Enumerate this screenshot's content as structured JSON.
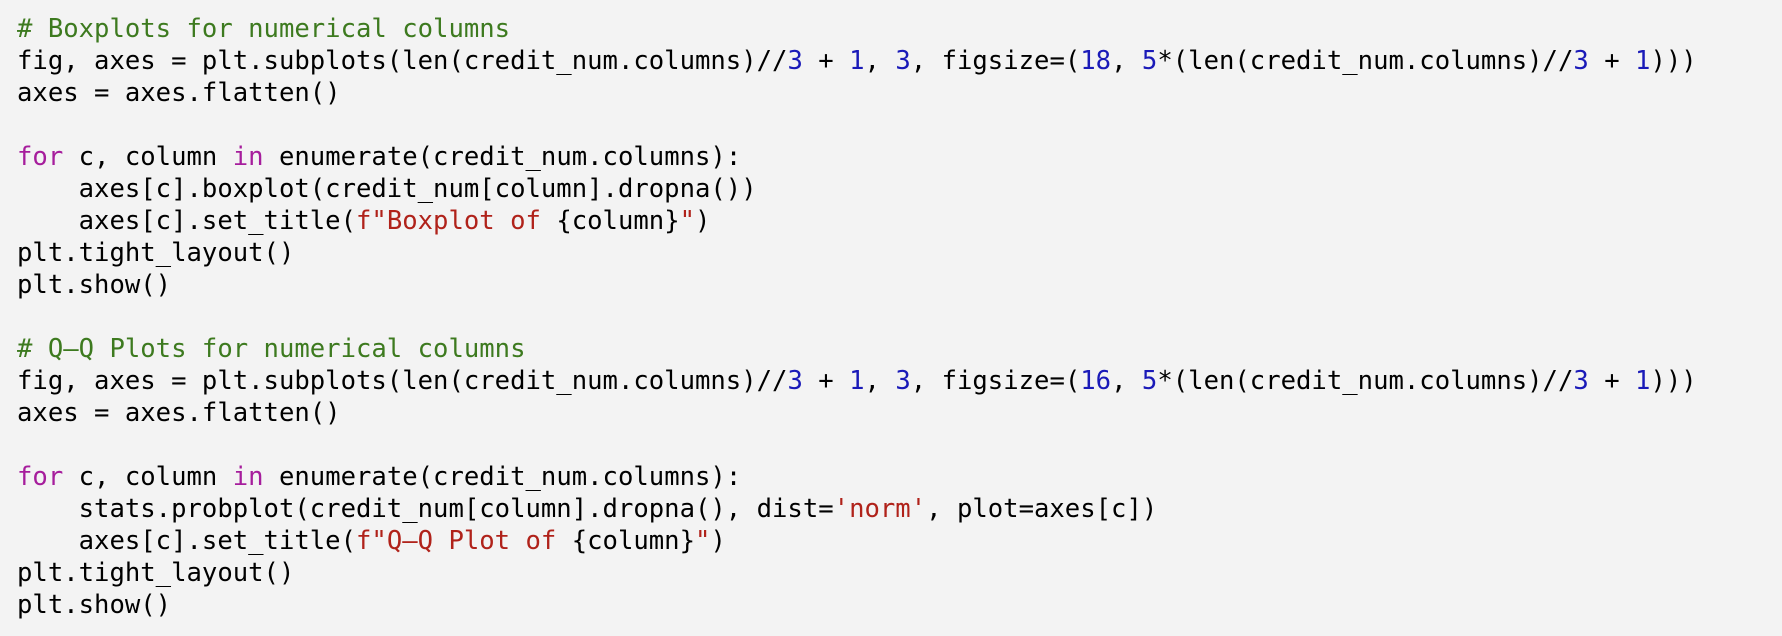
{
  "code_cell": {
    "colors": {
      "comment": "#3d7a1f",
      "number": "#1a1ab8",
      "keyword": "#a61d9c",
      "string": "#b0221a",
      "plain": "#000000",
      "background": "#f3f3f3"
    },
    "lines": [
      [
        {
          "t": "# Boxplots for numerical columns",
          "k": "comment"
        }
      ],
      [
        {
          "t": "fig, axes = plt.subplots(len(credit_num.columns)//",
          "k": "plain"
        },
        {
          "t": "3",
          "k": "number"
        },
        {
          "t": " + ",
          "k": "plain"
        },
        {
          "t": "1",
          "k": "number"
        },
        {
          "t": ", ",
          "k": "plain"
        },
        {
          "t": "3",
          "k": "number"
        },
        {
          "t": ", figsize=(",
          "k": "plain"
        },
        {
          "t": "18",
          "k": "number"
        },
        {
          "t": ", ",
          "k": "plain"
        },
        {
          "t": "5",
          "k": "number"
        },
        {
          "t": "*(len(credit_num.columns)//",
          "k": "plain"
        },
        {
          "t": "3",
          "k": "number"
        },
        {
          "t": " + ",
          "k": "plain"
        },
        {
          "t": "1",
          "k": "number"
        },
        {
          "t": ")))",
          "k": "plain"
        }
      ],
      [
        {
          "t": "axes = axes.flatten()",
          "k": "plain"
        }
      ],
      [],
      [
        {
          "t": "for",
          "k": "keyword"
        },
        {
          "t": " c, column ",
          "k": "plain"
        },
        {
          "t": "in",
          "k": "keyword"
        },
        {
          "t": " enumerate(credit_num.columns):",
          "k": "plain"
        }
      ],
      [
        {
          "t": "    axes[c].boxplot(credit_num[column].dropna())",
          "k": "plain"
        }
      ],
      [
        {
          "t": "    axes[c].set_title(",
          "k": "plain"
        },
        {
          "t": "f\"Boxplot of ",
          "k": "string"
        },
        {
          "t": "{column}",
          "k": "plain"
        },
        {
          "t": "\"",
          "k": "string"
        },
        {
          "t": ")",
          "k": "plain"
        }
      ],
      [
        {
          "t": "plt.tight_layout()",
          "k": "plain"
        }
      ],
      [
        {
          "t": "plt.show()",
          "k": "plain"
        }
      ],
      [],
      [
        {
          "t": "# Q–Q Plots for numerical columns",
          "k": "comment"
        }
      ],
      [
        {
          "t": "fig, axes = plt.subplots(len(credit_num.columns)//",
          "k": "plain"
        },
        {
          "t": "3",
          "k": "number"
        },
        {
          "t": " + ",
          "k": "plain"
        },
        {
          "t": "1",
          "k": "number"
        },
        {
          "t": ", ",
          "k": "plain"
        },
        {
          "t": "3",
          "k": "number"
        },
        {
          "t": ", figsize=(",
          "k": "plain"
        },
        {
          "t": "16",
          "k": "number"
        },
        {
          "t": ", ",
          "k": "plain"
        },
        {
          "t": "5",
          "k": "number"
        },
        {
          "t": "*(len(credit_num.columns)//",
          "k": "plain"
        },
        {
          "t": "3",
          "k": "number"
        },
        {
          "t": " + ",
          "k": "plain"
        },
        {
          "t": "1",
          "k": "number"
        },
        {
          "t": ")))",
          "k": "plain"
        }
      ],
      [
        {
          "t": "axes = axes.flatten()",
          "k": "plain"
        }
      ],
      [],
      [
        {
          "t": "for",
          "k": "keyword"
        },
        {
          "t": " c, column ",
          "k": "plain"
        },
        {
          "t": "in",
          "k": "keyword"
        },
        {
          "t": " enumerate(credit_num.columns):",
          "k": "plain"
        }
      ],
      [
        {
          "t": "    stats.probplot(credit_num[column].dropna(), dist=",
          "k": "plain"
        },
        {
          "t": "'norm'",
          "k": "string"
        },
        {
          "t": ", plot=axes[c])",
          "k": "plain"
        }
      ],
      [
        {
          "t": "    axes[c].set_title(",
          "k": "plain"
        },
        {
          "t": "f\"Q–Q Plot of ",
          "k": "string"
        },
        {
          "t": "{column}",
          "k": "plain"
        },
        {
          "t": "\"",
          "k": "string"
        },
        {
          "t": ")",
          "k": "plain"
        }
      ],
      [
        {
          "t": "plt.tight_layout()",
          "k": "plain"
        }
      ],
      [
        {
          "t": "plt.show()",
          "k": "plain"
        }
      ]
    ]
  }
}
